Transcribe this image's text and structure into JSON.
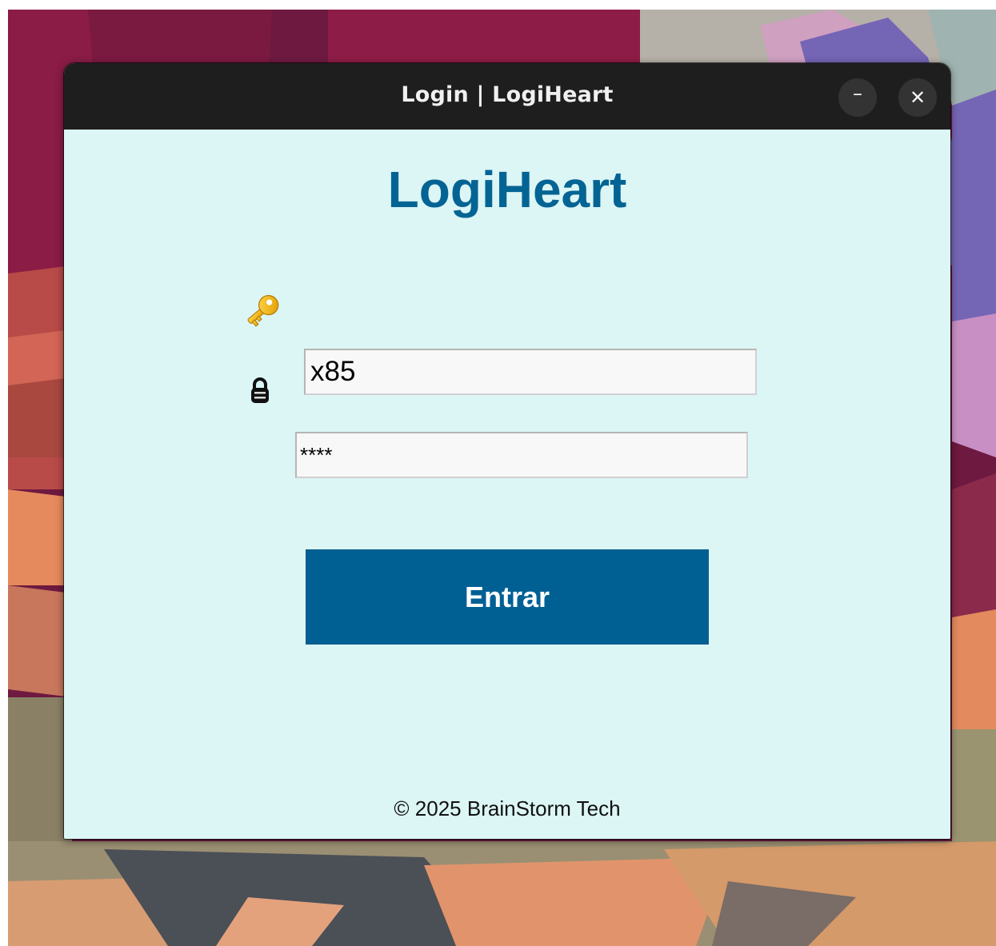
{
  "window": {
    "title": "Login | LogiHeart",
    "minimize_label": "–",
    "close_label": "✕"
  },
  "login": {
    "app_title": "LogiHeart",
    "username_icon": "key-icon",
    "username_value": "x85",
    "password_icon": "lock-icon",
    "password_value": "****",
    "submit_label": "Entrar",
    "footer": "© 2025 BrainStorm Tech"
  },
  "colors": {
    "title_color": "#036494",
    "button_bg": "#006094",
    "content_bg": "#dcf5f5",
    "titlebar_bg": "#1e1e1e"
  }
}
